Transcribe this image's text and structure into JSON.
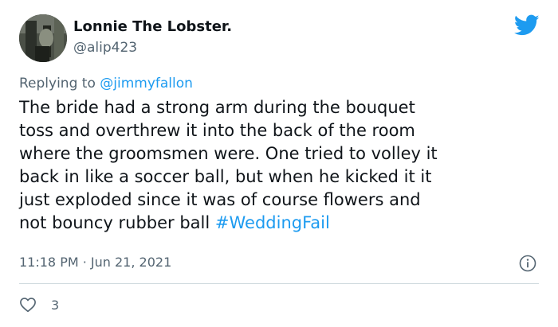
{
  "tweet": {
    "author": {
      "name": "Lonnie The Lobster.",
      "handle": "@alip423",
      "avatar_icon": "profile-photo"
    },
    "brand_icon": "twitter-bird-icon",
    "colors": {
      "accent": "#1d9bf0",
      "text": "#0f1419",
      "secondary": "#536471",
      "divider": "#cfd9de"
    },
    "replying": {
      "prefix": "Replying to",
      "mention": "@jimmyfallon"
    },
    "body": {
      "lines": [
        "The bride had a strong arm during the bouquet",
        "toss and overthrew it into the back of the room",
        "where the groomsmen were. One tried to volley it",
        "back in like a soccer ball, but when he kicked it it",
        "just exploded since it was of course flowers and",
        "not bouncy rubber ball"
      ],
      "hashtag": "#WeddingFail"
    },
    "timestamp": "11:18 PM · Jun 21, 2021",
    "likes": {
      "count": "3",
      "icon": "heart-icon"
    },
    "info_icon": "info-icon"
  }
}
